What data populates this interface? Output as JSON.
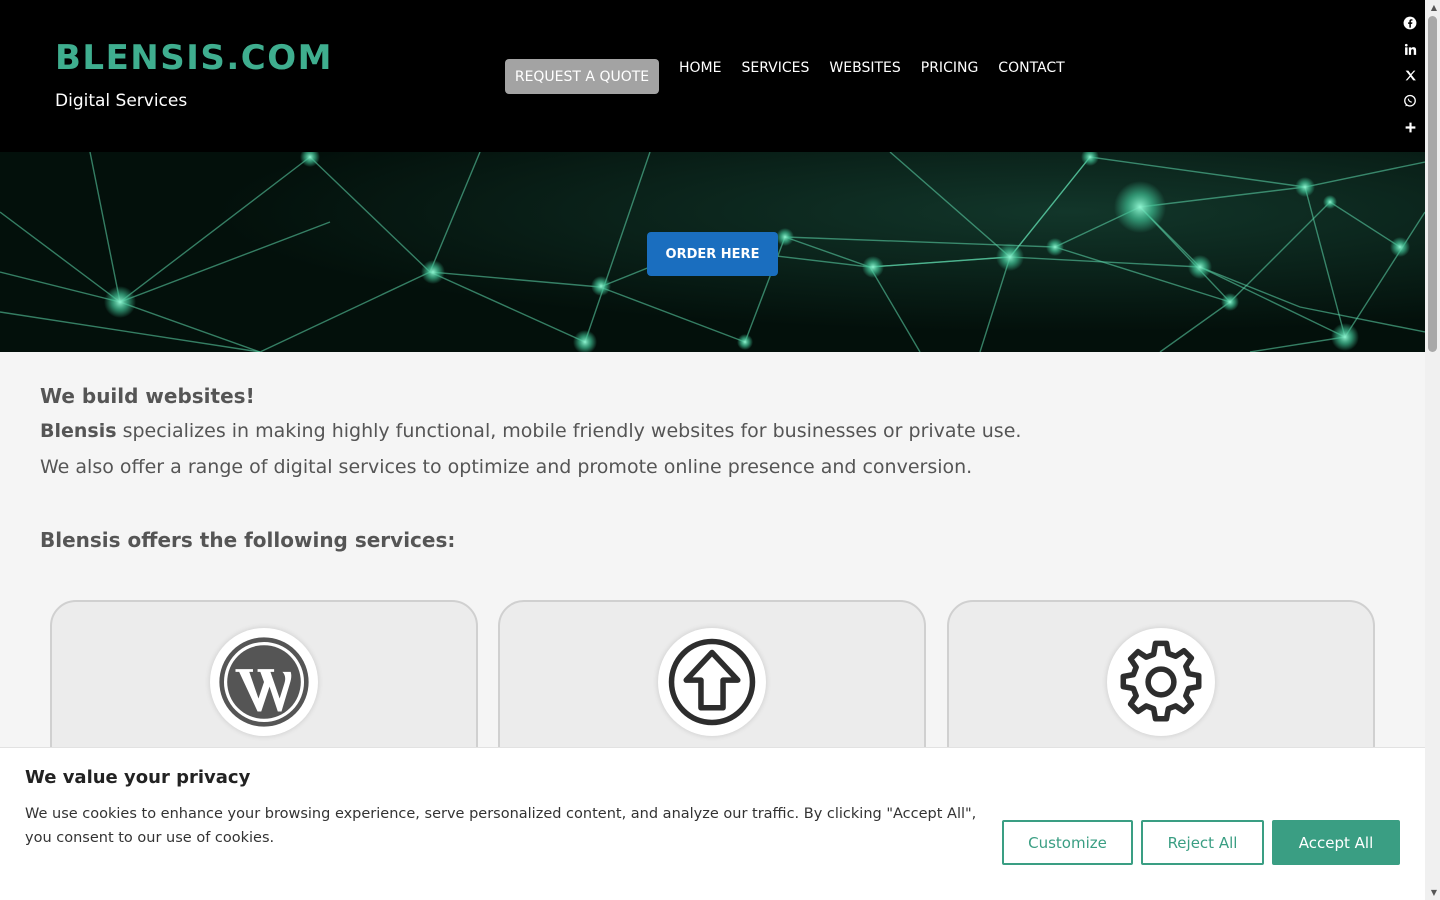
{
  "header": {
    "brand": "BLENSIS.COM",
    "tagline": "Digital Services",
    "quote_button": "REQUEST A QUOTE",
    "nav": [
      "HOME",
      "SERVICES",
      "WEBSITES",
      "PRICING",
      "CONTACT"
    ]
  },
  "social": {
    "icons": [
      "facebook-icon",
      "linkedin-icon",
      "x-icon",
      "whatsapp-icon",
      "plus-icon"
    ]
  },
  "hero": {
    "order_button": "ORDER HERE"
  },
  "main": {
    "heading": "We build websites!",
    "intro_bold": "Blensis",
    "intro_rest": " specializes in making highly functional, mobile friendly websites for businesses or private use.",
    "intro_2": "We also offer a range of digital services to optimize and promote online presence and conversion.",
    "services_heading": "Blensis offers the following services:",
    "cards": [
      {
        "icon": "wordpress-icon"
      },
      {
        "icon": "upload-arrow-icon"
      },
      {
        "icon": "gear-icon"
      }
    ]
  },
  "cookie": {
    "title": "We value your privacy",
    "text": "We use cookies to enhance your browsing experience, serve personalized content, and analyze our traffic. By clicking \"Accept All\", you consent to our use of cookies.",
    "customize": "Customize",
    "reject": "Reject All",
    "accept": "Accept All"
  },
  "colors": {
    "brand": "#3fae8f",
    "order_button": "#1a6ebf",
    "cookie_accent": "#3a9e83"
  }
}
